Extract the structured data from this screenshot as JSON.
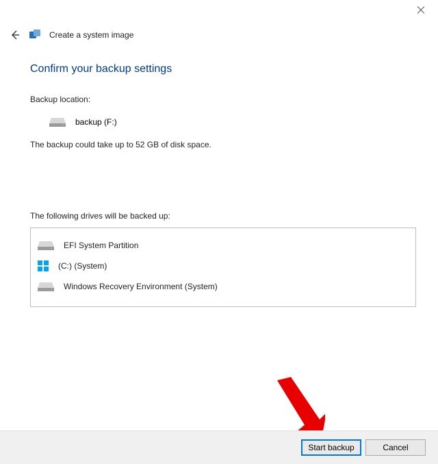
{
  "window": {
    "title": "Create a system image"
  },
  "heading": "Confirm your backup settings",
  "backup_location_label": "Backup location:",
  "backup_location_value": "backup (F:)",
  "size_note": "The backup could take up to 52 GB of disk space.",
  "drives_label": "The following drives will be backed up:",
  "drives": [
    {
      "name": "EFI System Partition",
      "icon": "drive"
    },
    {
      "name": "(C:) (System)",
      "icon": "windows"
    },
    {
      "name": "Windows Recovery Environment (System)",
      "icon": "drive"
    }
  ],
  "buttons": {
    "start": "Start backup",
    "cancel": "Cancel"
  }
}
